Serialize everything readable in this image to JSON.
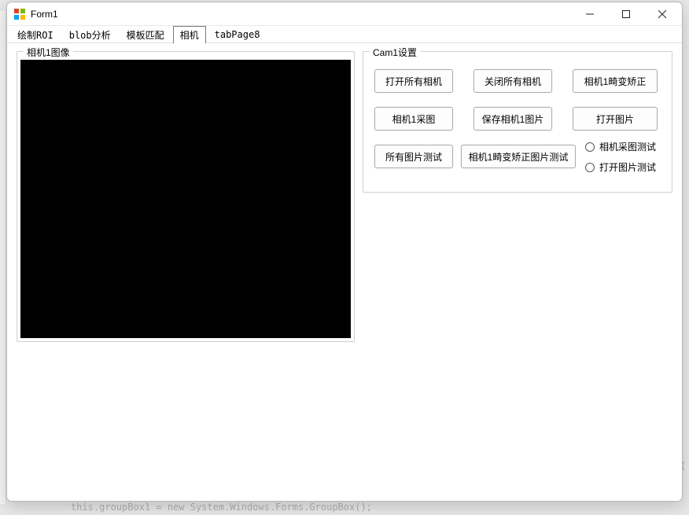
{
  "window": {
    "title": "Form1"
  },
  "tabs": {
    "items": [
      "绘制ROI",
      "blob分析",
      "模板匹配",
      "相机",
      "tabPage8"
    ],
    "active_index": 3
  },
  "image_group": {
    "legend": "相机1图像"
  },
  "cam_group": {
    "legend": "Cam1设置",
    "buttons": {
      "open_all": "打开所有相机",
      "close_all": "关闭所有相机",
      "distort_corr": "相机1畸变矫正",
      "cam1_capture": "相机1采图",
      "save_cam1_img": "保存相机1图片",
      "open_image": "打开图片",
      "all_img_test": "所有图片测试",
      "cam1_distort_img_test": "相机1畸变矫正图片测试"
    },
    "radios": {
      "cam_capture_test": "相机采图测试",
      "open_image_test": "打开图片测试"
    }
  },
  "background": {
    "code_line": "this.groupBox1 = new System.Windows.Forms.GroupBox();",
    "paren": "("
  }
}
